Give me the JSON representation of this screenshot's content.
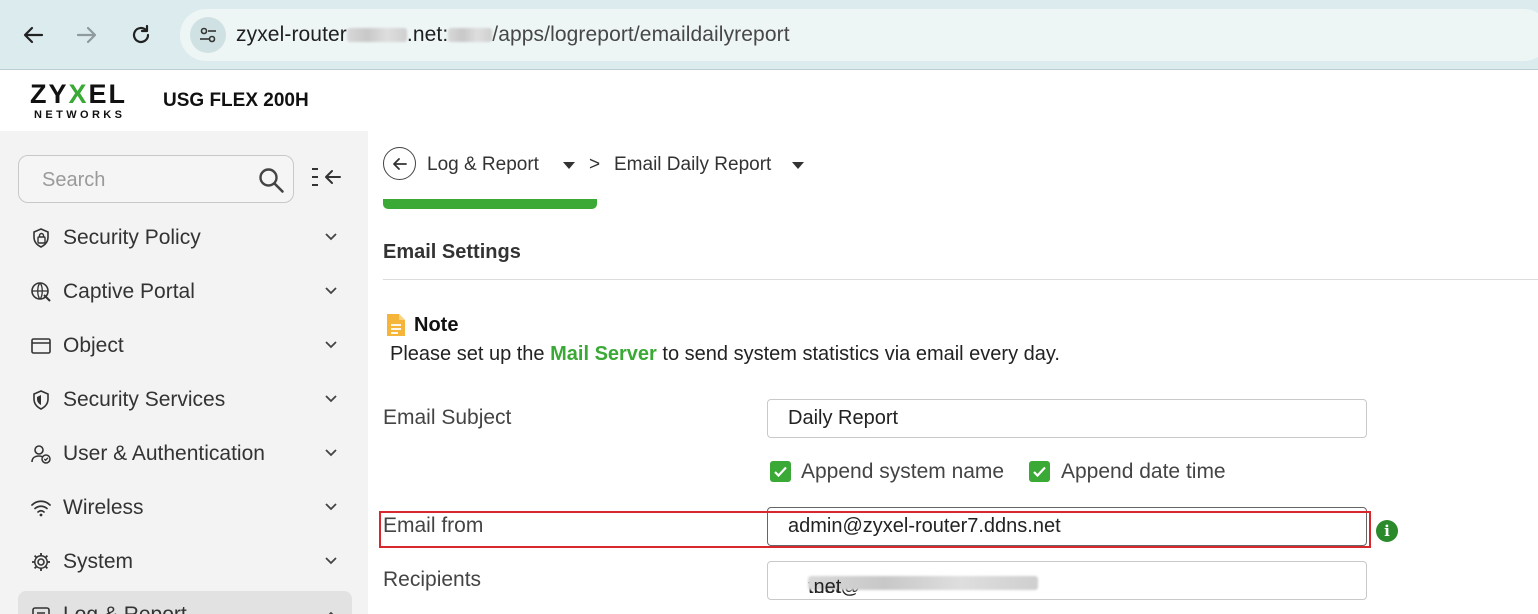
{
  "browser": {
    "url_host_prefix": "zyxel-router",
    "url_host_suffix": ".net:",
    "url_path": "/apps/logreport/emaildailyreport"
  },
  "header": {
    "logo_main_a": "ZY",
    "logo_main_x": "X",
    "logo_main_b": "EL",
    "logo_sub": "NETWORKS",
    "model": "USG FLEX 200H"
  },
  "sidebar": {
    "search_placeholder": "Search",
    "items": [
      {
        "label": "Security Policy",
        "icon": "shield-lock-icon"
      },
      {
        "label": "Captive Portal",
        "icon": "globe-portal-icon"
      },
      {
        "label": "Object",
        "icon": "object-card-icon"
      },
      {
        "label": "Security Services",
        "icon": "shield-icon"
      },
      {
        "label": "User & Authentication",
        "icon": "user-auth-icon"
      },
      {
        "label": "Wireless",
        "icon": "wifi-icon"
      },
      {
        "label": "System",
        "icon": "gear-icon"
      },
      {
        "label": "Log & Report",
        "icon": "log-report-icon"
      }
    ]
  },
  "breadcrumb": {
    "parent": "Log & Report",
    "separator": ">",
    "current": "Email Daily Report"
  },
  "main": {
    "section_title": "Email Settings",
    "note_title": "Note",
    "note_before": "Please set up the ",
    "note_link": "Mail Server",
    "note_after": " to send system statistics via email every day.",
    "fields": {
      "subject_label": "Email Subject",
      "subject_value": "Daily Report",
      "append_system_name": "Append system name",
      "append_date_time": "Append date time",
      "from_label": "Email from",
      "from_value": "admin@zyxel-router7.ddns.net",
      "recipients_label": "Recipients",
      "recipients_prefix": "test@",
      "recipients_suffix": ".net"
    }
  },
  "colors": {
    "accent": "#3aa935",
    "highlight": "#d9272e",
    "info": "#2b8a2b"
  }
}
